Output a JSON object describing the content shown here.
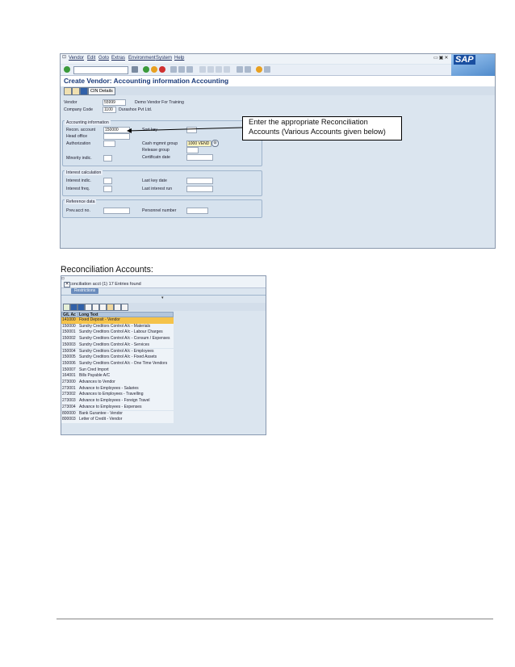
{
  "sap_window": {
    "menu": [
      "Vendor",
      "Edit",
      "Goto",
      "Extras",
      "Environment",
      "System",
      "Help"
    ],
    "logo_text": "SAP",
    "title": "Create Vendor: Accounting information Accounting",
    "app_toolbar": {
      "cin_details_label": "CIN Details"
    },
    "header_fields": {
      "vendor_label": "Vendor",
      "vendor_value": "55999",
      "vendor_desc": "Demo Vendor For Training",
      "company_code_label": "Company Code",
      "company_code_value": "1100",
      "company_code_desc": "Durashox Pvt Ltd."
    },
    "accounting_group": {
      "title": "Accounting information",
      "recon_account_label": "Recon. account",
      "recon_account_value": "150000",
      "head_office_label": "Head office",
      "authorization_label": "Authorization",
      "minority_label": "Minority indic.",
      "sort_key_label": "Sort key",
      "cash_mgmt_label": "Cash mgmnt group",
      "cash_mgmt_value": "1000 VEND",
      "release_group_label": "Release group",
      "certificatn_label": "Certificatn date"
    },
    "interest_group": {
      "title": "Interest calculation",
      "interest_indic_label": "Interest indic.",
      "interest_freq_label": "Interest freq.",
      "last_key_date_label": "Last key date",
      "last_interest_run_label": "Last interest run"
    },
    "reference_group": {
      "title": "Reference data",
      "prev_acct_label": "Prev.acct no.",
      "personnel_label": "Personnel number"
    }
  },
  "callout": {
    "line1": "Enter the appropriate Reconciliation",
    "line2": "Accounts (Various Accounts given below)"
  },
  "heading": "Reconciliation Accounts:",
  "popup": {
    "title": "Reconciliation acct (1)   17 Entries found",
    "tab_label": "Restrictions",
    "columns": [
      "G/L Ac",
      "Long Text"
    ],
    "rows": [
      {
        "acct": "141000",
        "text": "Fixed Deposit - Vendor",
        "selected": true
      },
      {
        "acct": "150000",
        "text": "Sundry Creditors Control A/c - Materials"
      },
      {
        "acct": "150001",
        "text": "Sundry Creditors Control A/c - Labour Charges"
      },
      {
        "acct": "150002",
        "text": "Sundry Creditors Control A/c - Consum / Expenses"
      },
      {
        "acct": "150003",
        "text": "Sundry Creditors Control A/c - Services"
      },
      {
        "acct": "150004",
        "text": "Sundry Creditors Control A/c - Employees"
      },
      {
        "acct": "150005",
        "text": "Sundry Creditors Control A/c - Fixed Assets"
      },
      {
        "acct": "150006",
        "text": "Sundry Creditors Control A/c - One Time Vendors"
      },
      {
        "acct": "150007",
        "text": "Sun Cred Import"
      },
      {
        "acct": "164001",
        "text": "Bills Payable A/C"
      },
      {
        "acct": "273000",
        "text": "Advances to Vendor"
      },
      {
        "acct": "273001",
        "text": "Advance to Employees - Salaries"
      },
      {
        "acct": "273002",
        "text": "Advances to Employees - Travelling"
      },
      {
        "acct": "273003",
        "text": "Advance to Employees - Foreign Travel"
      },
      {
        "acct": "273004",
        "text": "Advance to Employees - Expenses"
      },
      {
        "acct": "800000",
        "text": "Bank Gurantee - Vendor"
      },
      {
        "acct": "800003",
        "text": "Letter of Credit - Vendor"
      }
    ]
  }
}
